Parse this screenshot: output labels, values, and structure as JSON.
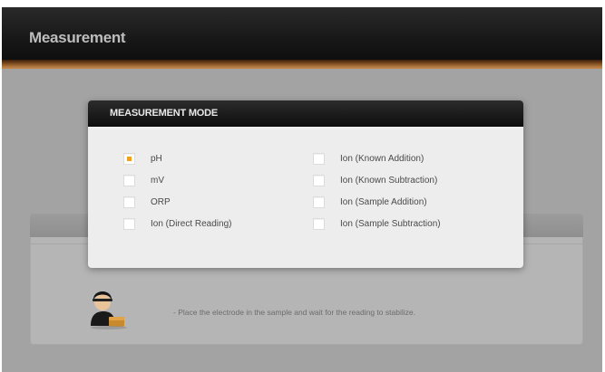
{
  "app": {
    "title": "Measurement"
  },
  "dialog": {
    "title": "MEASUREMENT MODE",
    "left_options": [
      {
        "label": "pH",
        "checked": true
      },
      {
        "label": "mV",
        "checked": false
      },
      {
        "label": "ORP",
        "checked": false
      },
      {
        "label": "Ion (Direct Reading)",
        "checked": false
      }
    ],
    "right_options": [
      {
        "label": "Ion (Known Addition)",
        "checked": false
      },
      {
        "label": "Ion (Known Subtraction)",
        "checked": false
      },
      {
        "label": "Ion (Sample Addition)",
        "checked": false
      },
      {
        "label": "Ion (Sample Subtraction)",
        "checked": false
      }
    ]
  },
  "instruction": {
    "text": "- Place the electrode in the sample and wait for the reading to stabilize."
  },
  "colors": {
    "accent_checked": "#f0a020",
    "header_bg": "#151515",
    "background": "#a3a3a3"
  },
  "icons": {
    "avatar": "operator-icon"
  }
}
